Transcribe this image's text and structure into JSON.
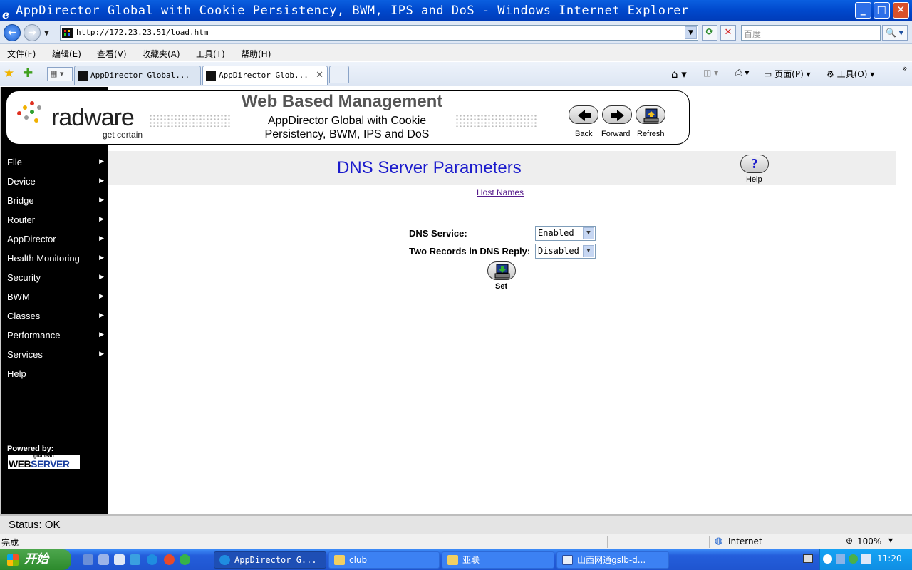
{
  "window": {
    "title": "AppDirector Global with Cookie Persistency, BWM, IPS and DoS - Windows Internet Explorer"
  },
  "address_bar": {
    "url": "http://172.23.23.51/load.htm",
    "search_placeholder": "百度"
  },
  "menu": {
    "items": [
      "文件(F)",
      "编辑(E)",
      "查看(V)",
      "收藏夹(A)",
      "工具(T)",
      "帮助(H)"
    ]
  },
  "tabs": [
    {
      "label": "AppDirector Global..."
    },
    {
      "label": "AppDirector Glob..."
    }
  ],
  "commands": {
    "page": "页面(P)",
    "tools": "工具(O)"
  },
  "sidebar": {
    "items": [
      {
        "label": "File",
        "has_submenu": true
      },
      {
        "label": "Device",
        "has_submenu": true
      },
      {
        "label": "Bridge",
        "has_submenu": true
      },
      {
        "label": "Router",
        "has_submenu": true
      },
      {
        "label": "AppDirector",
        "has_submenu": true
      },
      {
        "label": "Health Monitoring",
        "has_submenu": true
      },
      {
        "label": "Security",
        "has_submenu": true
      },
      {
        "label": "BWM",
        "has_submenu": true
      },
      {
        "label": "Classes",
        "has_submenu": true
      },
      {
        "label": "Performance",
        "has_submenu": true
      },
      {
        "label": "Services",
        "has_submenu": true
      },
      {
        "label": "Help",
        "has_submenu": false
      }
    ],
    "powered_by": "Powered by:",
    "webserver_small": "goahead",
    "webserver_a": "WEB",
    "webserver_b": "SERVER"
  },
  "header": {
    "logo_word": "radware",
    "logo_tagline": "get certain",
    "app_title": "Web Based Management",
    "product_name": "AppDirector Global with Cookie Persistency, BWM, IPS and DoS",
    "back_label": "Back",
    "forward_label": "Forward",
    "refresh_label": "Refresh"
  },
  "page": {
    "title": "DNS Server Parameters",
    "help_label": "Help",
    "host_names_link": "Host Names",
    "fields": [
      {
        "label": "DNS Service:",
        "value": "Enabled"
      },
      {
        "label": "Two Records in DNS Reply:",
        "value": "Disabled"
      }
    ],
    "set_label": "Set"
  },
  "app_status": "Status: OK",
  "ie_status": {
    "done": "完成",
    "zone": "Internet",
    "zoom": "100%"
  },
  "taskbar": {
    "start": "开始",
    "items": [
      {
        "label": "AppDirector G..."
      },
      {
        "label": "club"
      },
      {
        "label": "亚联"
      },
      {
        "label": "山西网通gslb-d..."
      }
    ],
    "clock": "11:20"
  },
  "colors": {
    "sidebar_bg": "#000000",
    "title_blue": "#1a1acc",
    "visited_link": "#551a8b",
    "xp_titlebar": "#0048cc"
  }
}
